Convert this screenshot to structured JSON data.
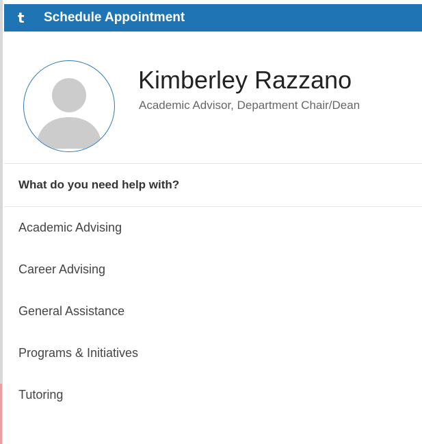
{
  "header": {
    "icon": "brand-t-icon",
    "icon_glyph": "t",
    "title": "Schedule Appointment"
  },
  "advisor": {
    "name": "Kimberley Razzano",
    "role": "Academic Advisor, Department Chair/Dean",
    "avatar_icon": "user-placeholder-icon"
  },
  "help": {
    "heading": "What do you need help with?",
    "options": [
      {
        "label": "Academic Advising"
      },
      {
        "label": "Career Advising"
      },
      {
        "label": "General Assistance"
      },
      {
        "label": "Programs & Initiatives"
      },
      {
        "label": "Tutoring"
      }
    ]
  },
  "colors": {
    "header_bg": "#1f74b4",
    "avatar_ring": "#2f78b8",
    "avatar_fill": "#cccccc"
  }
}
